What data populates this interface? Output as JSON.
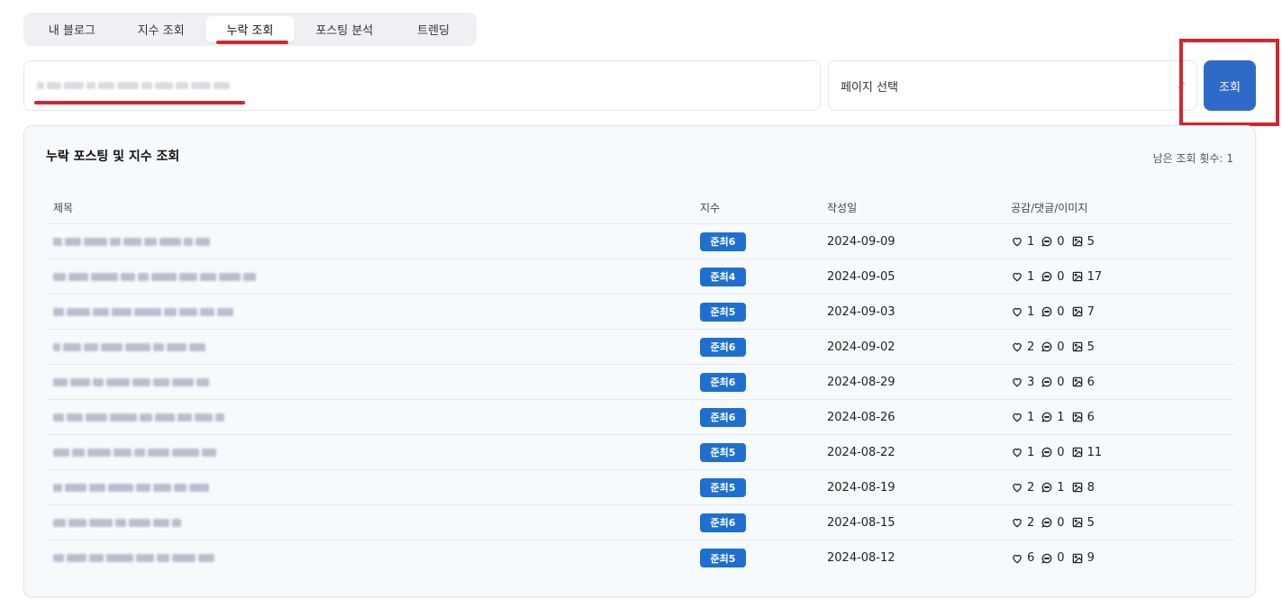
{
  "tabs": [
    {
      "label": "내 블로그",
      "active": false
    },
    {
      "label": "지수 조회",
      "active": false
    },
    {
      "label": "누락 조회",
      "active": true
    },
    {
      "label": "포스팅 분석",
      "active": false
    },
    {
      "label": "트렌딩",
      "active": false
    }
  ],
  "search": {
    "blog_url_value": "",
    "page_select": {
      "selected": "페이지 선택"
    },
    "button_label": "조회"
  },
  "results": {
    "title": "누락 포스팅 및 지수 조회",
    "remaining_label": "남은 조회 횟수: 1",
    "columns": {
      "title": "제목",
      "index": "지수",
      "date": "작성일",
      "stats": "공감/댓글/이미지"
    },
    "rows": [
      {
        "index": "준최6",
        "date": "2024-09-09",
        "likes": "1",
        "comments": "0",
        "images": "5"
      },
      {
        "index": "준최4",
        "date": "2024-09-05",
        "likes": "1",
        "comments": "0",
        "images": "17"
      },
      {
        "index": "준최5",
        "date": "2024-09-03",
        "likes": "1",
        "comments": "0",
        "images": "7"
      },
      {
        "index": "준최6",
        "date": "2024-09-02",
        "likes": "2",
        "comments": "0",
        "images": "5"
      },
      {
        "index": "준최6",
        "date": "2024-08-29",
        "likes": "3",
        "comments": "0",
        "images": "6"
      },
      {
        "index": "준최6",
        "date": "2024-08-26",
        "likes": "1",
        "comments": "1",
        "images": "6"
      },
      {
        "index": "준최5",
        "date": "2024-08-22",
        "likes": "1",
        "comments": "0",
        "images": "11"
      },
      {
        "index": "준최5",
        "date": "2024-08-19",
        "likes": "2",
        "comments": "1",
        "images": "8"
      },
      {
        "index": "준최6",
        "date": "2024-08-15",
        "likes": "2",
        "comments": "0",
        "images": "5"
      },
      {
        "index": "준최5",
        "date": "2024-08-12",
        "likes": "6",
        "comments": "0",
        "images": "9"
      }
    ]
  },
  "icons": {
    "likes": "heart-outline-icon",
    "comments": "speech-bubble-icon",
    "images": "image-icon"
  },
  "colors": {
    "accent": "#2e6bc9",
    "badge": "#1f6fd1",
    "highlight": "#d6252e"
  }
}
